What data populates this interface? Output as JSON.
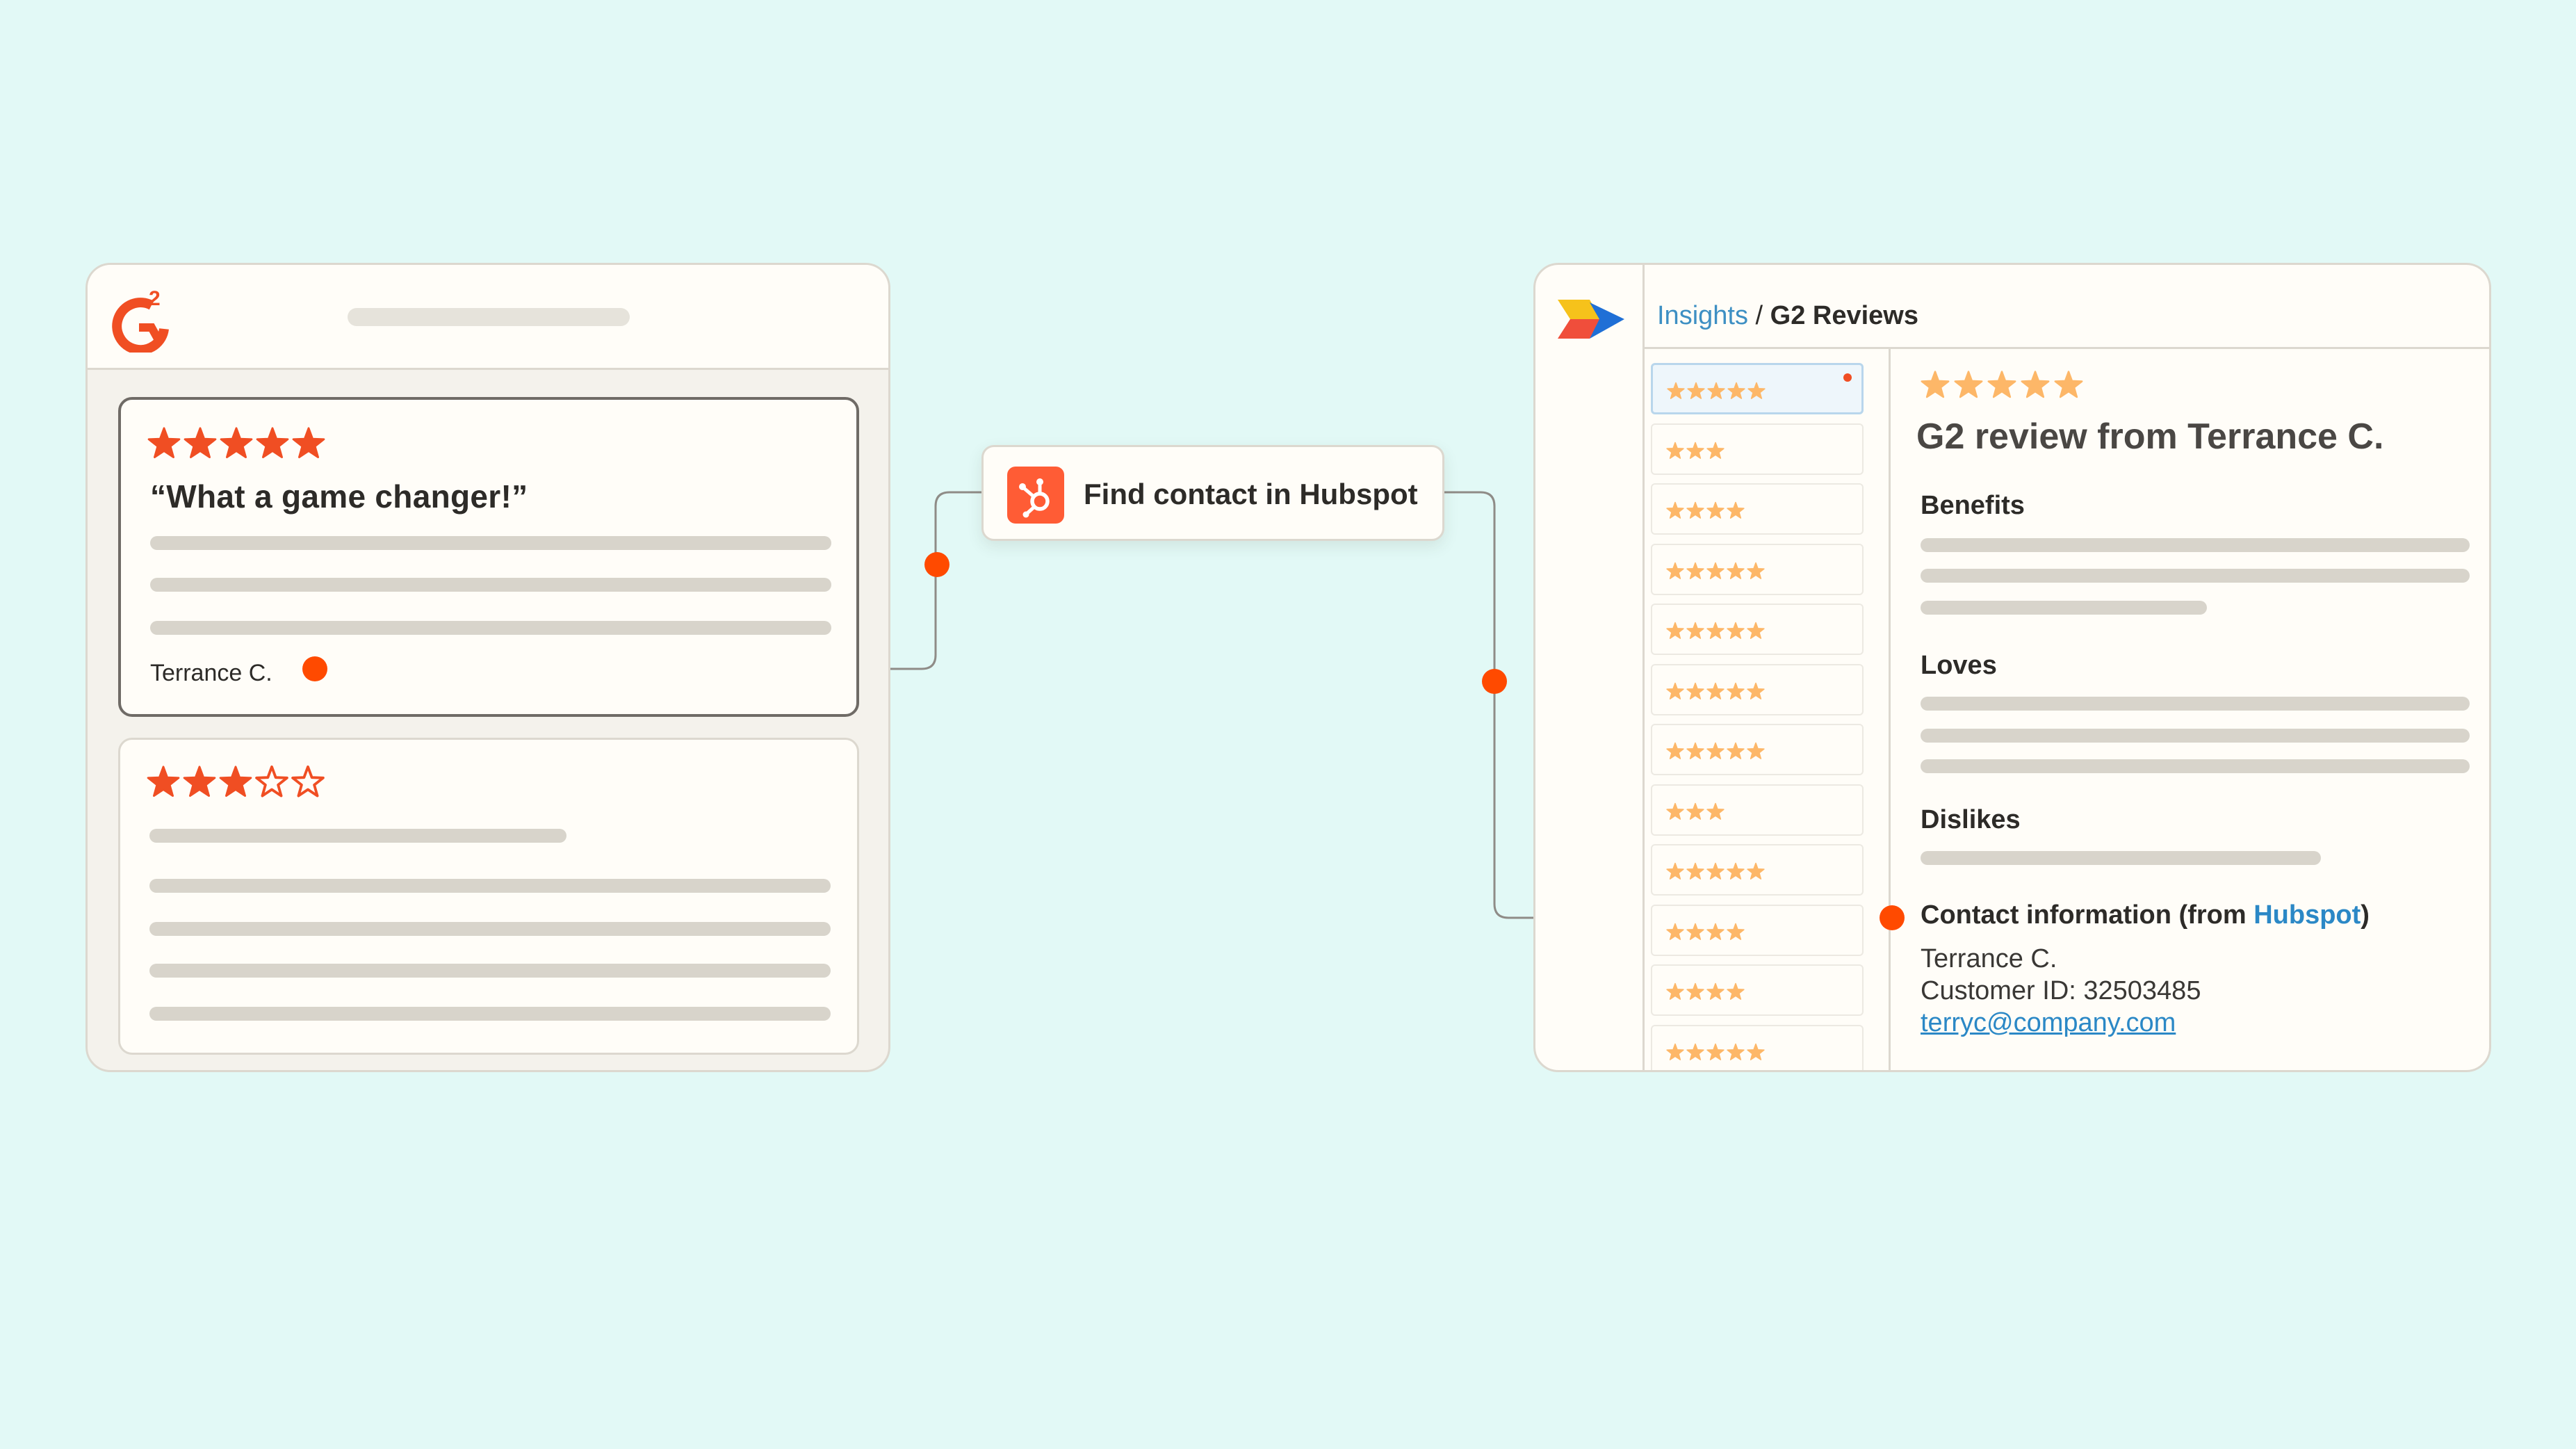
{
  "g2_panel": {
    "logo_icon": "g2-logo-icon",
    "reviews": [
      {
        "rating": 5,
        "quote": "“What a game changer!”",
        "reviewer": "Terrance C."
      },
      {
        "rating": 3
      }
    ]
  },
  "workflow_step": {
    "icon": "hubspot-icon",
    "label": "Find contact in Hubspot"
  },
  "insights_app": {
    "logo_icon": "app-logo-icon",
    "breadcrumb": {
      "parent": "Insights",
      "separator": "/",
      "current": "G2 Reviews"
    },
    "review_list": [
      {
        "rating": 5,
        "selected": true,
        "unread": true
      },
      {
        "rating": 3
      },
      {
        "rating": 4
      },
      {
        "rating": 5
      },
      {
        "rating": 5
      },
      {
        "rating": 5
      },
      {
        "rating": 5
      },
      {
        "rating": 3
      },
      {
        "rating": 5
      },
      {
        "rating": 4
      },
      {
        "rating": 4
      },
      {
        "rating": 5
      }
    ],
    "detail": {
      "rating": 5,
      "title": "G2 review from Terrance C.",
      "benefits_label": "Benefits",
      "loves_label": "Loves",
      "dislikes_label": "Dislikes",
      "contact_label_prefix": "Contact information (from ",
      "contact_label_source": "Hubspot",
      "contact_label_suffix": ")",
      "contact_name": "Terrance C.",
      "customer_id": "Customer ID: 32503485",
      "email": "terryc@company.com"
    }
  },
  "colors": {
    "background": "#e2f9f6",
    "g2_star": "#f04e23",
    "list_star": "#fdb768",
    "connector_dot": "#ff4a00",
    "link_blue": "#2b88c6",
    "hubspot_orange": "#ff5c35"
  }
}
